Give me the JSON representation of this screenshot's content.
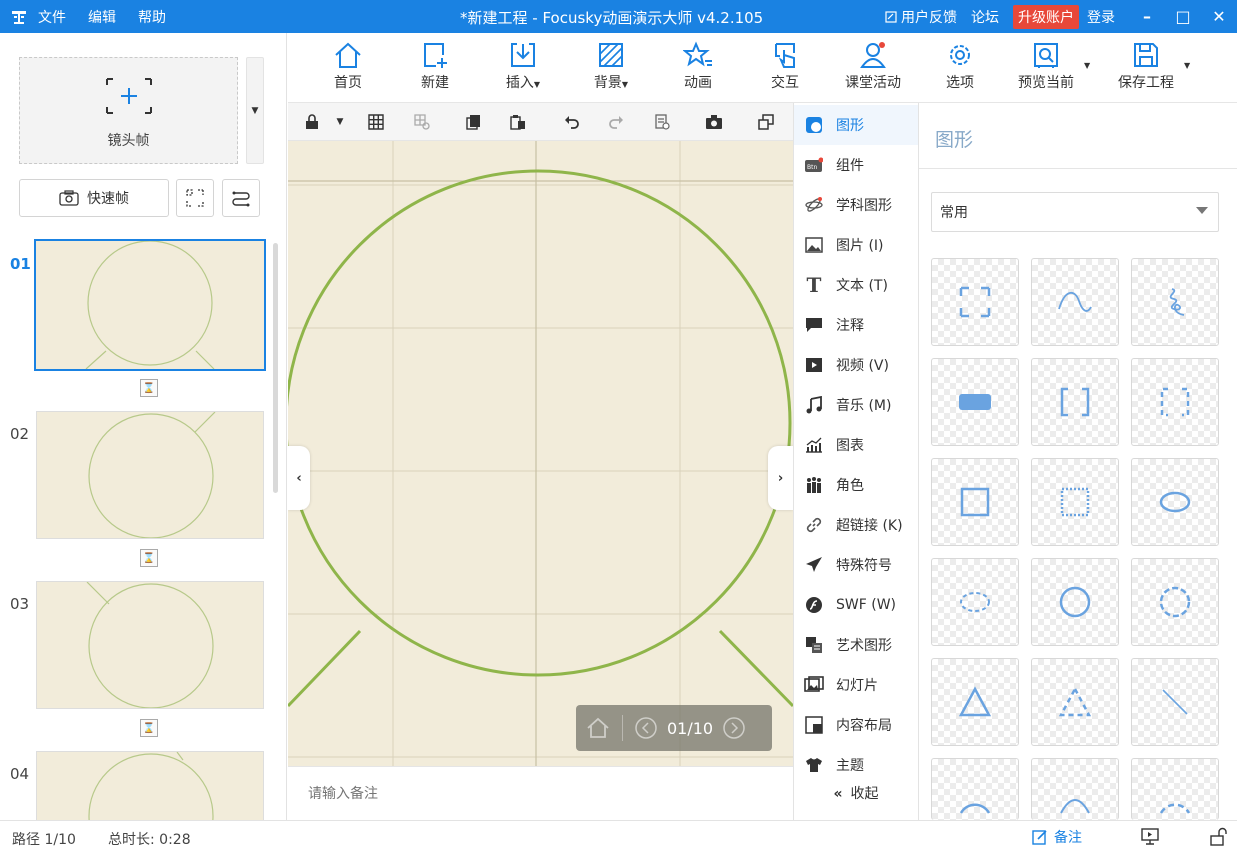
{
  "titlebar": {
    "menu": [
      "文件",
      "编辑",
      "帮助"
    ],
    "title": "*新建工程 - Focusky动画演示大师  v4.2.105",
    "feedback": "用户反馈",
    "forum": "论坛",
    "upgrade": "升级账户",
    "login": "登录"
  },
  "left": {
    "frame_label": "镜头帧",
    "quick_label": "快速帧",
    "slides": [
      "01",
      "02",
      "03",
      "04"
    ]
  },
  "toolbar": {
    "items": [
      "首页",
      "新建",
      "插入",
      "背景",
      "动画",
      "交互",
      "课堂活动",
      "选项",
      "预览当前",
      "保存工程"
    ]
  },
  "canvas": {
    "page_indicator": "01/10",
    "notes_placeholder": "请输入备注"
  },
  "categories": {
    "items": [
      "图形",
      "组件",
      "学科图形",
      "图片 (I)",
      "文本 (T)",
      "注释",
      "视频 (V)",
      "音乐 (M)",
      "图表",
      "角色",
      "超链接 (K)",
      "特殊符号",
      "SWF (W)",
      "艺术图形",
      "幻灯片",
      "内容布局",
      "主题"
    ],
    "collapse": "收起"
  },
  "shapes": {
    "title": "图形",
    "filter_value": "常用"
  },
  "status": {
    "path": "路径 1/10",
    "duration": "总时长: 0:28",
    "notes": "备注"
  },
  "colors": {
    "accent": "#1a82e2",
    "upgrade": "#e8483a",
    "canvas_bg": "#f2ecda",
    "circle": "#8fb54a",
    "shape_blue": "#6aa3e0"
  }
}
